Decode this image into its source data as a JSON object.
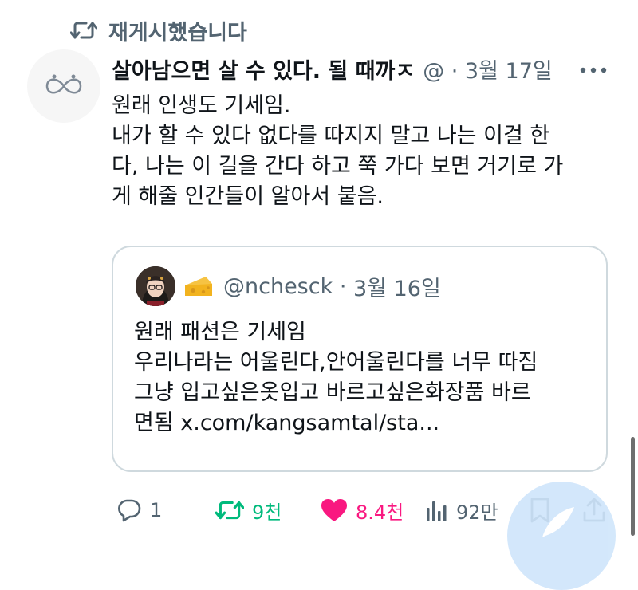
{
  "retweet": {
    "icon": "retweet-icon",
    "label": "재게시했습니다"
  },
  "tweet": {
    "author_name": "살아남으면 살 수 있다. 될 때까ㅈ",
    "meta": "@ · 3월 17일",
    "more_icon": "more-icon",
    "text_lines": [
      "원래 인생도 기세임.",
      "내가 할 수 있다 없다를 따지지 말고 나는 이걸 한",
      "다, 나는 이 길을 간다 하고 쭉 가다 보면 거기로 가",
      "게 해줄 인간들이 알아서 붙음."
    ]
  },
  "quote": {
    "emoji_icon": "cheese-icon",
    "handle": "@nchesck",
    "separator": " · ",
    "date": "3월 16일",
    "text_lines": [
      "원래 패션은 기세임",
      "우리나라는 어울린다,안어울린다를 너무 따짐",
      "그냥 입고싶은옷입고 바르고싶은화장품 바르",
      "면됨 x.com/kangsamtal/sta..."
    ]
  },
  "actions": {
    "reply_count": "1",
    "retweet_count": "9천",
    "like_count": "8.4천",
    "views_count": "92만"
  },
  "colors": {
    "text": "#0f1419",
    "muted": "#536471",
    "retweet_green": "#00ba7c",
    "like_pink": "#f91880",
    "border": "#cfd9de"
  }
}
